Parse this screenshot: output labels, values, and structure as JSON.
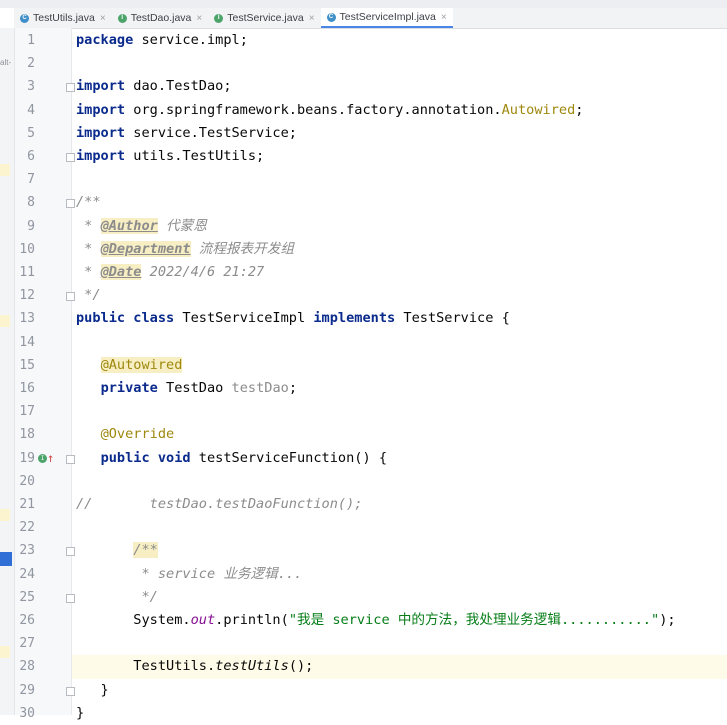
{
  "tabs": [
    {
      "label": "TestUtils.java",
      "icon": "class-icon",
      "active": false
    },
    {
      "label": "TestDao.java",
      "icon": "interface-icon",
      "active": false
    },
    {
      "label": "TestService.java",
      "icon": "interface-icon",
      "active": false
    },
    {
      "label": "TestServiceImpl.java",
      "icon": "class-icon",
      "active": true
    }
  ],
  "tab_icon_letters": {
    "class": "C",
    "interface": "I"
  },
  "close_glyph": "×",
  "strip_label": "alt-",
  "lines": [
    {
      "n": "1",
      "segs": [
        [
          "kw",
          "package"
        ],
        [
          "",
          "  service.impl;"
        ]
      ]
    },
    {
      "n": "2",
      "segs": []
    },
    {
      "n": "3",
      "segs": [
        [
          "kw",
          "import"
        ],
        [
          "",
          "  dao.TestDao;"
        ]
      ],
      "fold": true
    },
    {
      "n": "4",
      "segs": [
        [
          "kw",
          "import"
        ],
        [
          "",
          "  org.springframework.beans.factory.annotation."
        ],
        [
          "ann",
          "Autowired"
        ],
        [
          "",
          ";"
        ]
      ]
    },
    {
      "n": "5",
      "segs": [
        [
          "kw",
          "import"
        ],
        [
          "",
          "  service.TestService;"
        ]
      ]
    },
    {
      "n": "6",
      "segs": [
        [
          "kw",
          "import"
        ],
        [
          "",
          "  utils.TestUtils;"
        ]
      ],
      "fold": true
    },
    {
      "n": "7",
      "segs": []
    },
    {
      "n": "8",
      "segs": [
        [
          "cm",
          "/**"
        ]
      ],
      "fold": true
    },
    {
      "n": "9",
      "segs": [
        [
          "cm",
          " * "
        ],
        [
          "tagc",
          "@Author"
        ],
        [
          "cm",
          " 代蒙恩"
        ]
      ]
    },
    {
      "n": "10",
      "segs": [
        [
          "cm",
          " * "
        ],
        [
          "tagc",
          "@Department"
        ],
        [
          "cm",
          " 流程报表开发组"
        ]
      ]
    },
    {
      "n": "11",
      "segs": [
        [
          "cm",
          " * "
        ],
        [
          "tagc",
          "@Date"
        ],
        [
          "cm",
          " 2022/4/6 21:27"
        ]
      ]
    },
    {
      "n": "12",
      "segs": [
        [
          "cm",
          " */"
        ]
      ],
      "fold": true
    },
    {
      "n": "13",
      "segs": [
        [
          "kw",
          "public class"
        ],
        [
          "",
          "  TestServiceImpl "
        ],
        [
          "kw",
          "implements"
        ],
        [
          "",
          "  TestService {"
        ]
      ]
    },
    {
      "n": "14",
      "segs": []
    },
    {
      "n": "15",
      "segs": [
        [
          "",
          "    "
        ],
        [
          "ann anbg",
          "@Autowired"
        ]
      ]
    },
    {
      "n": "16",
      "segs": [
        [
          "",
          "    "
        ],
        [
          "kw",
          "private"
        ],
        [
          "",
          "  TestDao "
        ],
        [
          "fld",
          "testDao"
        ],
        [
          "",
          ";"
        ]
      ]
    },
    {
      "n": "17",
      "segs": []
    },
    {
      "n": "18",
      "segs": [
        [
          "",
          "    "
        ],
        [
          "ann",
          "@Override"
        ]
      ]
    },
    {
      "n": "19",
      "segs": [
        [
          "",
          "    "
        ],
        [
          "kw",
          "public void"
        ],
        [
          "",
          "  testServiceFunction() {"
        ]
      ],
      "fold": true,
      "impl": true
    },
    {
      "n": "20",
      "segs": []
    },
    {
      "n": "21",
      "segs": [
        [
          "cm",
          "//        testDao.testDaoFunction();"
        ]
      ]
    },
    {
      "n": "22",
      "segs": []
    },
    {
      "n": "23",
      "segs": [
        [
          "",
          "        "
        ],
        [
          "cm anbg",
          "/**"
        ]
      ],
      "fold": true
    },
    {
      "n": "24",
      "segs": [
        [
          "cm",
          "         * service 业务逻辑..."
        ]
      ]
    },
    {
      "n": "25",
      "segs": [
        [
          "cm",
          "         */"
        ]
      ],
      "fold": true
    },
    {
      "n": "26",
      "segs": [
        [
          "",
          "        System."
        ],
        [
          "stat",
          "out"
        ],
        [
          "",
          ".println("
        ],
        [
          "str",
          "\"我是 service 中的方法，我处理业务逻辑...........\""
        ],
        [
          "",
          ");"
        ]
      ]
    },
    {
      "n": "27",
      "segs": []
    },
    {
      "n": "28",
      "segs": [
        [
          "",
          "        TestUtils."
        ],
        [
          "statm",
          "testUtils"
        ],
        [
          "",
          "();"
        ]
      ],
      "current": true
    },
    {
      "n": "29",
      "segs": [
        [
          "",
          "    }"
        ]
      ],
      "fold": true
    },
    {
      "n": "30",
      "segs": [
        [
          "",
          "}"
        ]
      ]
    }
  ]
}
